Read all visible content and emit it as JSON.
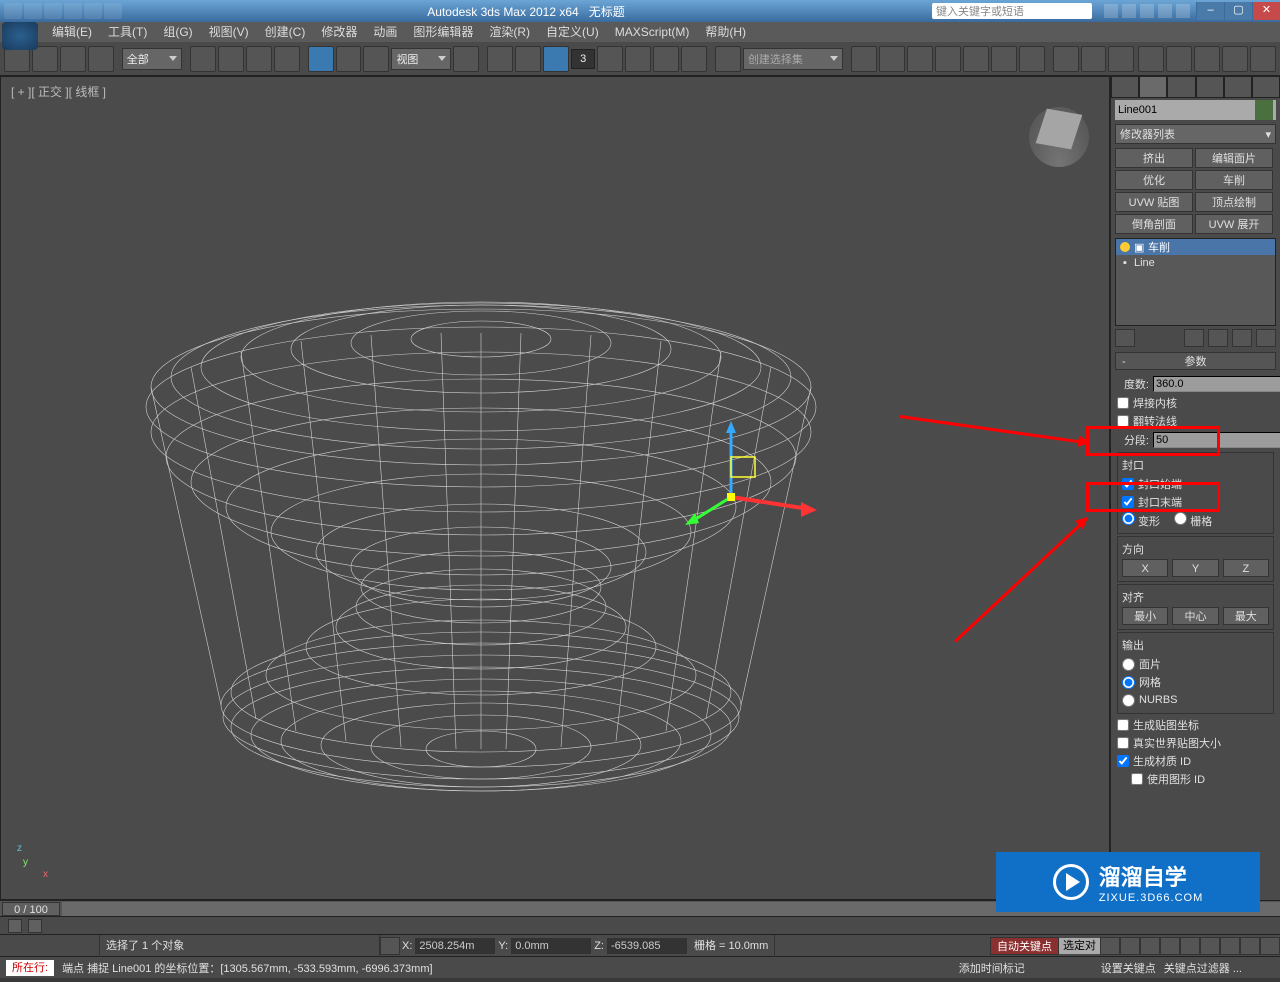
{
  "titlebar": {
    "app_title": "Autodesk 3ds Max 2012 x64",
    "doc_title": "无标题",
    "search_placeholder": "键入关键字或短语"
  },
  "menu": {
    "items": [
      "编辑(E)",
      "工具(T)",
      "组(G)",
      "视图(V)",
      "创建(C)",
      "修改器",
      "动画",
      "图形编辑器",
      "渲染(R)",
      "自定义(U)",
      "MAXScript(M)",
      "帮助(H)"
    ]
  },
  "toolbar": {
    "filter": "全部",
    "view_dd": "视图",
    "spin_val": "3",
    "selset_placeholder": "创建选择集"
  },
  "viewport": {
    "label": "[ + ][ 正交 ][ 线框 ]"
  },
  "cmdpanel": {
    "object_name": "Line001",
    "modlist_dd": "修改器列表",
    "mod_buttons": [
      "挤出",
      "编辑面片",
      "优化",
      "车削",
      "UVW 贴图",
      "顶点绘制",
      "倒角剖面",
      "UVW 展开"
    ],
    "stack": {
      "current": "车削",
      "base": "Line"
    },
    "rollout": {
      "params_title": "参数",
      "degrees_label": "度数:",
      "degrees_value": "360.0",
      "weld_core": "焊接内核",
      "flip_normals": "翻转法线",
      "segments_label": "分段:",
      "segments_value": "50",
      "cap_title": "封口",
      "cap_start": "封口始端",
      "cap_end": "封口末端",
      "morph": "变形",
      "grid": "栅格",
      "dir_title": "方向",
      "dir_x": "X",
      "dir_y": "Y",
      "dir_z": "Z",
      "align_title": "对齐",
      "align_min": "最小",
      "align_center": "中心",
      "align_max": "最大",
      "output_title": "输出",
      "out_patch": "面片",
      "out_mesh": "网格",
      "out_nurbs": "NURBS",
      "gen_mapping": "生成贴图坐标",
      "real_world": "真实世界贴图大小",
      "gen_matid": "生成材质 ID",
      "use_shapeid": "使用图形 ID"
    }
  },
  "timeline": {
    "frames": "0 / 100"
  },
  "midbar": {
    "chip1": "",
    "chip2": ""
  },
  "status": {
    "selected": "选择了 1 个对象",
    "x_label": "X:",
    "x_val": "2508.254m",
    "y_label": "Y:",
    "y_val": "0.0mm",
    "z_label": "Z:",
    "z_val": "-6539.085",
    "grid": "栅格 = 10.0mm",
    "autokey": "自动关键点",
    "keysel": "选定对",
    "setkey": "设置关键点",
    "keyfilter": "关键点过滤器 ..."
  },
  "prompt": {
    "pill_red": "所在行:",
    "hint": "端点 捕捉 Line001 的坐标位置：[1305.567mm, -533.593mm, -6996.373mm]",
    "addtime": "添加时间标记"
  },
  "watermark": {
    "brand": "溜溜自学",
    "sub": "ZIXUE.3D66.COM"
  },
  "chart_data": null
}
